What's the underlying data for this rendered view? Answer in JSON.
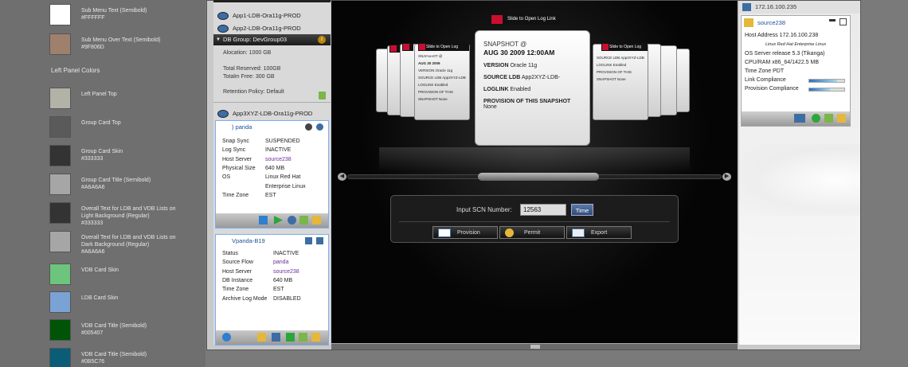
{
  "legend": {
    "swatches_top": [
      {
        "title": "Sub Menu Text (Semibold)",
        "hex": "#FFFFFF",
        "color": "#FFFFFF"
      },
      {
        "title": "Sub Menu Over Text (Semibold)",
        "hex": "#9F806D",
        "color": "#9F806D"
      }
    ],
    "section_title": "Left Panel Colors",
    "swatches": [
      {
        "title": "Left Panel Top",
        "hex": "",
        "color": "#b2b2a6"
      },
      {
        "title": "Group Card Top",
        "hex": "",
        "color": "#5a5a5a"
      },
      {
        "title": "Group Card Skin",
        "hex": "#333333",
        "color": "#333333"
      },
      {
        "title": "Group Card Title (Semibold)",
        "hex": "#A6A6A6",
        "color": "#A6A6A6"
      },
      {
        "title": "Overall Text for LDB and VDB Lists on Light Background (Regular)",
        "hex": "#333333",
        "color": "#333333"
      },
      {
        "title": "Overall Text for LDB and VDB Lists on Dark Background (Regular)",
        "hex": "#A6A6A6",
        "color": "#A6A6A6"
      },
      {
        "title": "VDB Card Skin",
        "hex": "",
        "color": "#6dc47d"
      },
      {
        "title": "LDB Card Skin",
        "hex": "",
        "color": "#7aa2d4"
      },
      {
        "title": "VDB Card Title (Semibold)",
        "hex": "#005407",
        "color": "#005407"
      },
      {
        "title": "VDB Card Title (Semibold)",
        "hex": "#0B5C76",
        "color": "#0B5C76"
      }
    ]
  },
  "left_panel": {
    "apps": [
      "App1-LDB-Ora11g-PROD",
      "App2-LDB-Ora11g-PROD"
    ],
    "group_bar": "DB Group: DevGroup03",
    "allocation": "Alocation: 1000 GB",
    "total_reserved": "Total Reserved: 100GB",
    "total_free": "Totalm Free: 300 GB",
    "retention": "Retention Policy: Default",
    "app3": "App3XYZ-LDB-Ora11g-PROD",
    "card1": {
      "title": ") panda",
      "rows": [
        {
          "k": "Snap Sync",
          "v": "SUSPENDED"
        },
        {
          "k": "Log Sync",
          "v": "INACTIVE"
        },
        {
          "k": "Host Server",
          "v": "source238"
        },
        {
          "k": "Physical Size",
          "v": "640 MB"
        },
        {
          "k": "OS",
          "v": "Linux Red Hat"
        },
        {
          "k": "",
          "v": "Enterprise Linux"
        },
        {
          "k": "Time Zone",
          "v": "EST"
        }
      ]
    },
    "card2": {
      "title": "Vpanda-B19",
      "rows": [
        {
          "k": "Status",
          "v": "INACTIVE"
        },
        {
          "k": "Source Flow",
          "v": "panda"
        },
        {
          "k": "Host Server",
          "v": "source238"
        },
        {
          "k": "DB Instance",
          "v": "640 MB"
        },
        {
          "k": "Time Zone",
          "v": "EST"
        },
        {
          "k": "Archive Log Mode",
          "v": "DISABLED"
        }
      ]
    }
  },
  "center": {
    "slide_tag": "Slide to Open Log Link",
    "snapshot": {
      "label": "SNAPSHOT @",
      "date": "AUG 30 2009 12:00AM",
      "version_label": "VERSION",
      "version": "Oracle 11g",
      "source_label": "SOURCE LDB",
      "source": "App2XYZ-LDB-",
      "loglink_label": "LOGLINK",
      "loglink": "Enabled",
      "provision_label": "PROVISION OF THIS SNAPSHOT",
      "provision": "None"
    },
    "mini_tag": "Slide to Open Log Link",
    "mini_lines": [
      "SNAPSHOT @",
      "AUG 30 2009",
      "VERSION Oracle 11g",
      "SOURCE LDB App2XYZ-LDB",
      "LOGLINK Enabled",
      "PROVISION OF THIS SNAPSHOT None"
    ],
    "scn_label": "Input SCN Number:",
    "scn_value": "12563",
    "time_button": "Time",
    "actions": [
      "Provision",
      "Permit",
      "Export"
    ]
  },
  "right_panel": {
    "ip": "172.16.100.235",
    "card": {
      "title": "source238",
      "host": "Host Address 172.16.100.238",
      "subtitle": "Linux Red Hat Enterprise Linux",
      "os": "OS Server release 5.3 (Tikanga)",
      "cpu": "CPU/RAM x86_64/1422.5 MB",
      "tz": "Time Zone PDT",
      "link": "Link Compliance",
      "prov": "Provision Compliance",
      "link_level": 0.8,
      "prov_level": 0.6
    }
  }
}
